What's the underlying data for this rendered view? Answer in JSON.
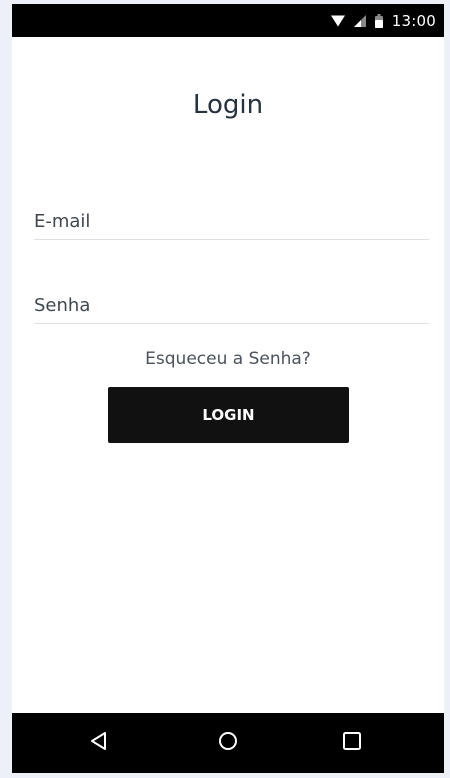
{
  "status_bar": {
    "time": "13:00",
    "icons": [
      "wifi-icon",
      "signal-icon",
      "battery-icon"
    ]
  },
  "login": {
    "title": "Login",
    "email_placeholder": "E-mail",
    "email_value": "",
    "password_placeholder": "Senha",
    "password_value": "",
    "forgot_label": "Esqueceu a Senha?",
    "button_label": "LOGIN"
  },
  "nav_bar": {
    "icons": [
      "back-icon",
      "home-icon",
      "recent-apps-icon"
    ]
  },
  "colors": {
    "background": "#eef0f7",
    "surface": "#ffffff",
    "system_bar": "#000000",
    "title_text": "#273240",
    "button_bg": "#111111",
    "button_text": "#ffffff",
    "divider": "#dfe1e6"
  }
}
